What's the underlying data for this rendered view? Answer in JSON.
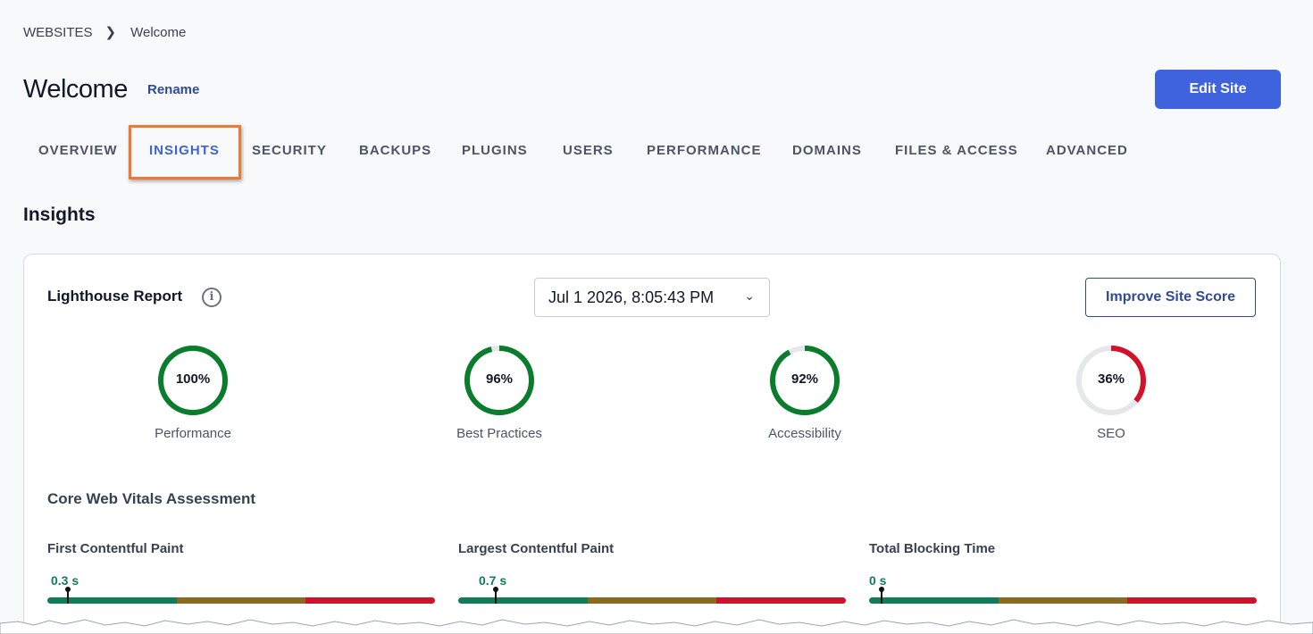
{
  "breadcrumb": {
    "root": "WEBSITES",
    "current": "Welcome"
  },
  "header": {
    "title": "Welcome",
    "rename": "Rename",
    "edit_button": "Edit Site"
  },
  "tabs": [
    {
      "label": "OVERVIEW",
      "active": false
    },
    {
      "label": "INSIGHTS",
      "active": true
    },
    {
      "label": "SECURITY",
      "active": false
    },
    {
      "label": "BACKUPS",
      "active": false
    },
    {
      "label": "PLUGINS",
      "active": false
    },
    {
      "label": "USERS",
      "active": false
    },
    {
      "label": "PERFORMANCE",
      "active": false
    },
    {
      "label": "DOMAINS",
      "active": false
    },
    {
      "label": "FILES & ACCESS",
      "active": false
    },
    {
      "label": "ADVANCED",
      "active": false
    }
  ],
  "section_title": "Insights",
  "lighthouse": {
    "title": "Lighthouse Report",
    "info_icon": "info-icon",
    "date_selected": "Jul 1 2026, 8:05:43 PM",
    "improve_button": "Improve Site Score",
    "scores": [
      {
        "label": "Performance",
        "value": 100,
        "text": "100%",
        "color": "#0a7d2c"
      },
      {
        "label": "Best Practices",
        "value": 96,
        "text": "96%",
        "color": "#0a7d2c"
      },
      {
        "label": "Accessibility",
        "value": 92,
        "text": "92%",
        "color": "#0a7d2c"
      },
      {
        "label": "SEO",
        "value": 36,
        "text": "36%",
        "color": "#d0132a"
      }
    ],
    "track_color": "#e5e7eb"
  },
  "core_web_vitals": {
    "title": "Core Web Vitals Assessment",
    "colors": {
      "good": "#0f7d5a",
      "needs_improvement": "#8a6a1e",
      "poor": "#d0132a"
    },
    "metrics": [
      {
        "name": "First Contentful Paint",
        "value_text": "0.3 s",
        "position": 0.05
      },
      {
        "name": "Largest Contentful Paint",
        "value_text": "0.7 s",
        "position": 0.095
      },
      {
        "name": "Total Blocking Time",
        "value_text": "0 s",
        "position": 0.03
      }
    ]
  }
}
